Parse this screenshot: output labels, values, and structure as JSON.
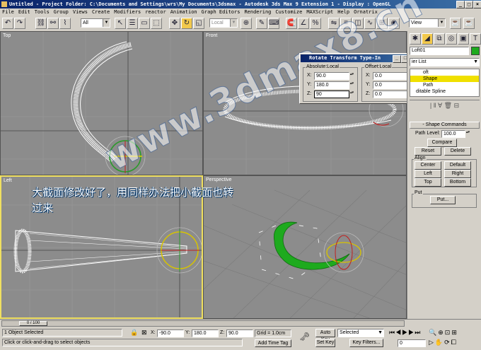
{
  "titlebar": {
    "text": "Untitled    - Project Folder: C:\\Documents and Settings\\wrs\\My Documents\\3dsmax    - Autodesk 3ds Max 9 Extension 1    - Display : OpenGL",
    "min": "_",
    "max": "□",
    "close": "×"
  },
  "menubar": [
    "File",
    "Edit",
    "Tools",
    "Group",
    "Views",
    "Create",
    "Modifiers",
    "reactor",
    "Animation",
    "Graph Editors",
    "Rendering",
    "Customize",
    "MAXScript",
    "Help",
    "Ornatrix"
  ],
  "toolbar": {
    "selection_filter": "All",
    "ref_coord": "Local",
    "named_selection": "View"
  },
  "viewports": {
    "top": "Top",
    "front": "Front",
    "left": "Left",
    "perspective": "Perspective"
  },
  "overlay": {
    "caption_line1": "大截面修改好了，用同样办法把小截面也转",
    "caption_line2": "过来",
    "watermark": "www.3dmax8.cn"
  },
  "dialog": {
    "title": "Rotate Transform Type-In",
    "absolute_label": "Absolute:Local",
    "offset_label": "Offset:Local",
    "abs_x": "90.0",
    "abs_y": "180.0",
    "abs_z": "90",
    "off_x": "0.0",
    "off_y": "0.0",
    "off_z": "0.0",
    "x_label": "X:",
    "y_label": "Y:",
    "z_label": "Z:"
  },
  "command_panel": {
    "object_name": "Loft01",
    "modifier_list": "ier List",
    "stack": [
      "oft",
      "Shape",
      "Path",
      "ditable Spline"
    ],
    "rollout_title": "Shape Commands",
    "path_level_label": "Path Level:",
    "path_level_value": "100.0",
    "compare": "Compare",
    "reset": "Reset",
    "delete": "Delete",
    "align_label": "Align",
    "center": "Center",
    "default": "Default",
    "left": "Left",
    "right": "Right",
    "top": "Top",
    "bottom": "Bottom",
    "put_label": "Put",
    "put": "Put...",
    "accent_color": "#f0e000",
    "object_color": "#1eaa1e"
  },
  "timeline": {
    "frame_counter": "0 / 100"
  },
  "status": {
    "selected": "1 Object Selected",
    "prompt": "Click or click-and-drag to select objects",
    "x_label": "X:",
    "x_value": "-90.0",
    "y_label": "Y:",
    "y_value": "180.0",
    "z_label": "Z:",
    "z_value": "90.0",
    "grid": "Grid = 1.0cm",
    "add_time_tag": "Add Time Tag",
    "auto_key": "Auto Key",
    "set_key": "Set Key",
    "key_mode": "Selected",
    "key_filters": "Key Filters...",
    "frame": "0"
  }
}
